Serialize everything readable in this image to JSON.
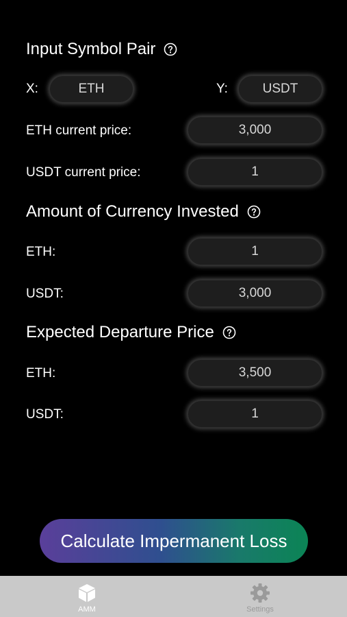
{
  "sections": {
    "symbol_pair": {
      "title": "Input Symbol Pair",
      "x_label": "X:",
      "x_value": "ETH",
      "y_label": "Y:",
      "y_value": "USDT",
      "eth_price_label": "ETH current price:",
      "eth_price_value": "3,000",
      "usdt_price_label": "USDT current price:",
      "usdt_price_value": "1"
    },
    "invested": {
      "title": "Amount of Currency Invested",
      "eth_label": "ETH:",
      "eth_value": "1",
      "usdt_label": "USDT:",
      "usdt_value": "3,000"
    },
    "departure": {
      "title": "Expected Departure Price",
      "eth_label": "ETH:",
      "eth_value": "3,500",
      "usdt_label": "USDT:",
      "usdt_value": "1"
    }
  },
  "calculate_button": "Calculate Impermanent Loss",
  "tabbar": {
    "tabs": [
      {
        "label": "AMM",
        "icon": "cube-icon",
        "active": true
      },
      {
        "label": "Settings",
        "icon": "gear-icon",
        "active": false
      }
    ]
  },
  "colors": {
    "background": "#000000",
    "field_background": "#1e1e1e",
    "button_gradient_start": "#5a3f9a",
    "button_gradient_end": "#0b8455",
    "tabbar_background": "#c9c9c9"
  }
}
